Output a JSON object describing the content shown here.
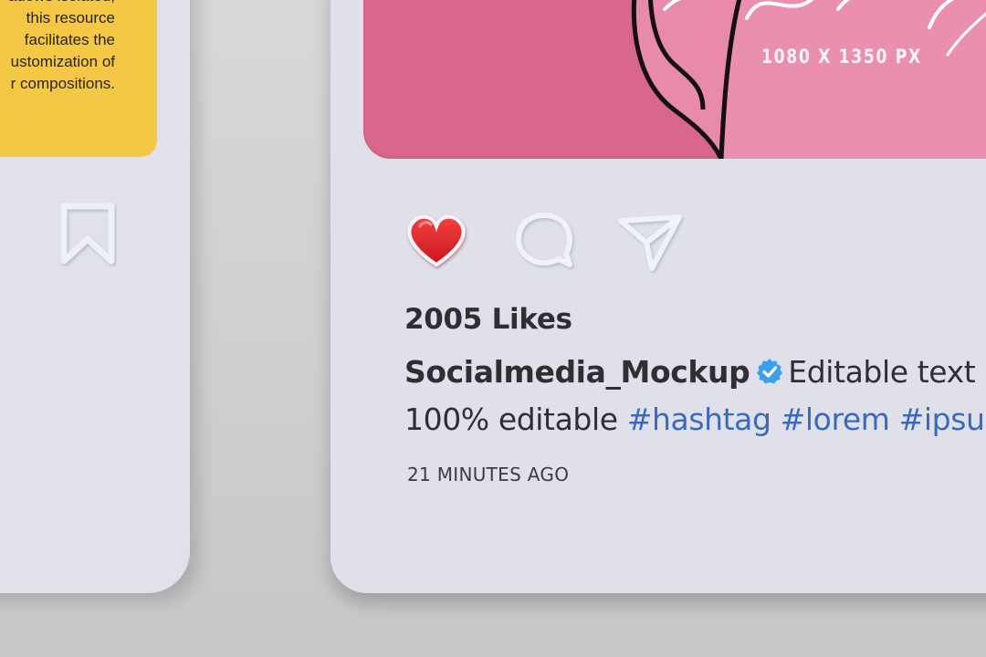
{
  "left_post": {
    "description": "adows isolated,\nthis resource\nfacilitates the\nustomization of\nr compositions."
  },
  "right_post": {
    "size_label": "1080 X 1350 PX",
    "likes": "2005 Likes",
    "username": "Socialmedia_Mockup",
    "caption": "Editable text",
    "caption_line2_text": "100% editable",
    "hashtags": [
      "#hashtag",
      "#lorem",
      "#ipsu"
    ],
    "time_ago": "21 MINUTES AGO"
  },
  "icons": {
    "left": [
      "bookmark-icon"
    ],
    "right": [
      "heart-icon",
      "comment-icon",
      "share-icon",
      "verified-badge-icon"
    ]
  },
  "colors": {
    "yellow_panel": "#f4c845",
    "pink_panel": "#d9668c",
    "heart": "#e3262b",
    "hashtag": "#3a6ab9",
    "verified": "#3aa0ee",
    "card": "#dfe0ea"
  }
}
